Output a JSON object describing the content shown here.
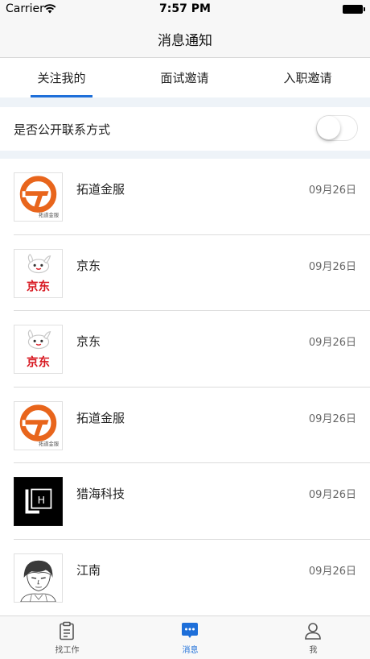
{
  "status_bar": {
    "carrier": "Carrier",
    "time": "7:57 PM"
  },
  "nav": {
    "title": "消息通知"
  },
  "tabs": [
    {
      "label": "关注我的",
      "active": true
    },
    {
      "label": "面试邀请",
      "active": false
    },
    {
      "label": "入职邀请",
      "active": false
    }
  ],
  "privacy": {
    "label": "是否公开联系方式",
    "enabled": false
  },
  "messages": [
    {
      "company": "拓道金服",
      "date": "09月26日",
      "logo": "tuodao-logo",
      "logo_text": "拓道金服"
    },
    {
      "company": "京东",
      "date": "09月26日",
      "logo": "jd-logo",
      "logo_text": "京东"
    },
    {
      "company": "京东",
      "date": "09月26日",
      "logo": "jd-logo",
      "logo_text": "京东"
    },
    {
      "company": "拓道金服",
      "date": "09月26日",
      "logo": "tuodao-logo",
      "logo_text": "拓道金服"
    },
    {
      "company": "猎海科技",
      "date": "09月26日",
      "logo": "liehai-logo",
      "logo_text": "LH"
    },
    {
      "company": "江南",
      "date": "09月26日",
      "logo": "sketch-avatar",
      "logo_text": ""
    }
  ],
  "tab_bar": [
    {
      "label": "找工作",
      "icon": "clipboard-icon",
      "active": false
    },
    {
      "label": "消息",
      "icon": "chat-bubble-icon",
      "active": true
    },
    {
      "label": "我",
      "icon": "person-icon",
      "active": false
    }
  ],
  "colors": {
    "accent": "#1e6fd9",
    "tuodao_orange": "#e8651c",
    "jd_red": "#d7161f"
  }
}
